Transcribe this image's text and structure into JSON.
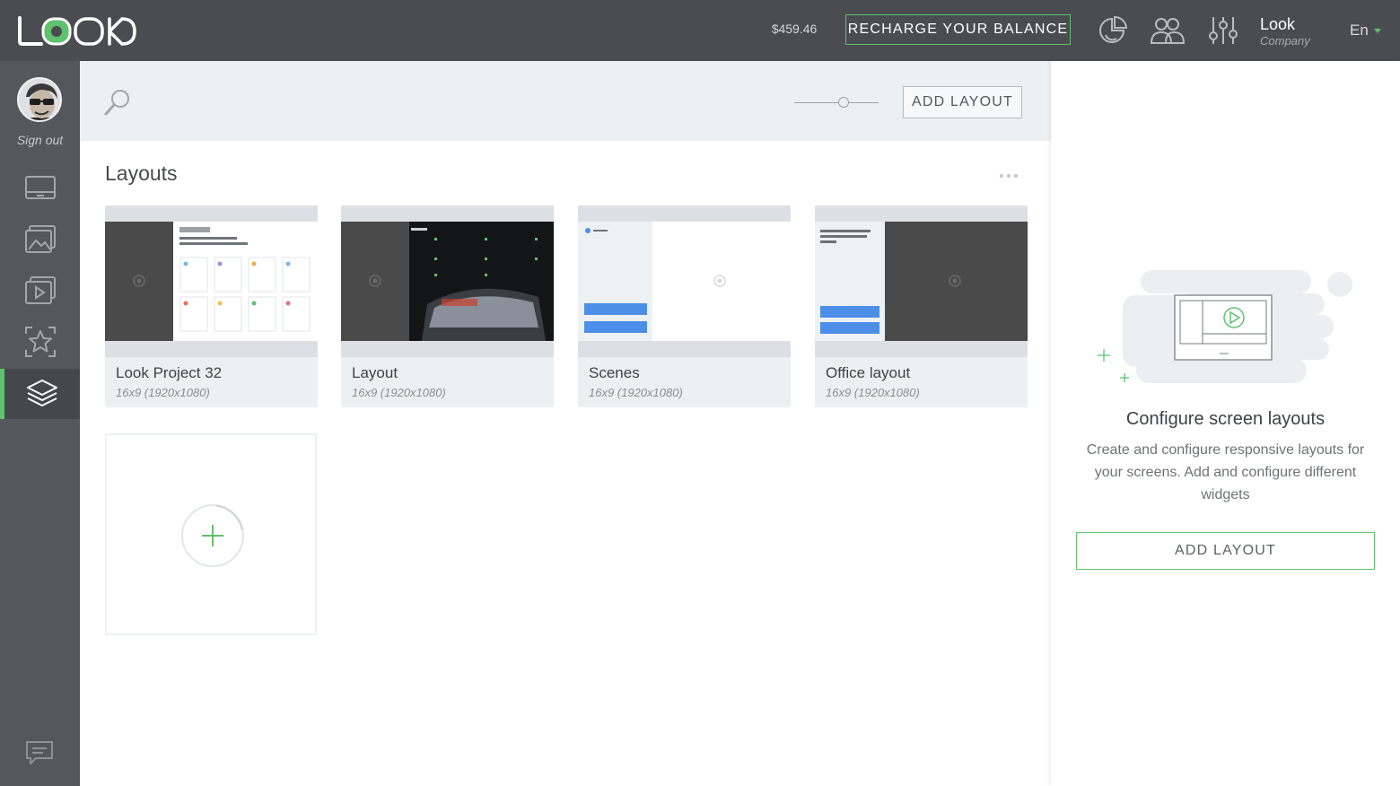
{
  "header": {
    "logo_text": "LOOK",
    "balance": "$459.46",
    "recharge_label": "RECHARGE YOUR BALANCE",
    "icons": [
      "analytics-pie-icon",
      "users-icon",
      "settings-sliders-icon"
    ],
    "account_name": "Look",
    "account_type": "Company",
    "language": "En"
  },
  "sidebar": {
    "signout_label": "Sign out",
    "items": [
      {
        "name": "screens-icon",
        "active": false
      },
      {
        "name": "images-icon",
        "active": false
      },
      {
        "name": "playlists-icon",
        "active": false
      },
      {
        "name": "widgets-icon",
        "active": false
      },
      {
        "name": "layouts-icon",
        "active": true
      }
    ],
    "chat_icon": "chat-icon"
  },
  "toolbar": {
    "search_icon": "search-icon",
    "zoom_level": 0.6,
    "add_layout_label": "ADD LAYOUT"
  },
  "main": {
    "section_title": "Layouts",
    "layouts": [
      {
        "title": "Look Project 32",
        "subtitle": "16x9 (1920x1080)"
      },
      {
        "title": "Layout",
        "subtitle": "16x9 (1920x1080)"
      },
      {
        "title": "Scenes",
        "subtitle": "16x9 (1920x1080)"
      },
      {
        "title": "Office layout",
        "subtitle": "16x9 (1920x1080)"
      }
    ]
  },
  "right_panel": {
    "title": "Configure screen layouts",
    "description": "Create and configure responsive layouts for your screens. Add and configure different widgets",
    "button_label": "ADD LAYOUT"
  },
  "colors": {
    "accent": "#5fc26e",
    "topbar": "#4a4c51",
    "sidebar": "#55575c",
    "toolbar": "#edf0f3"
  }
}
